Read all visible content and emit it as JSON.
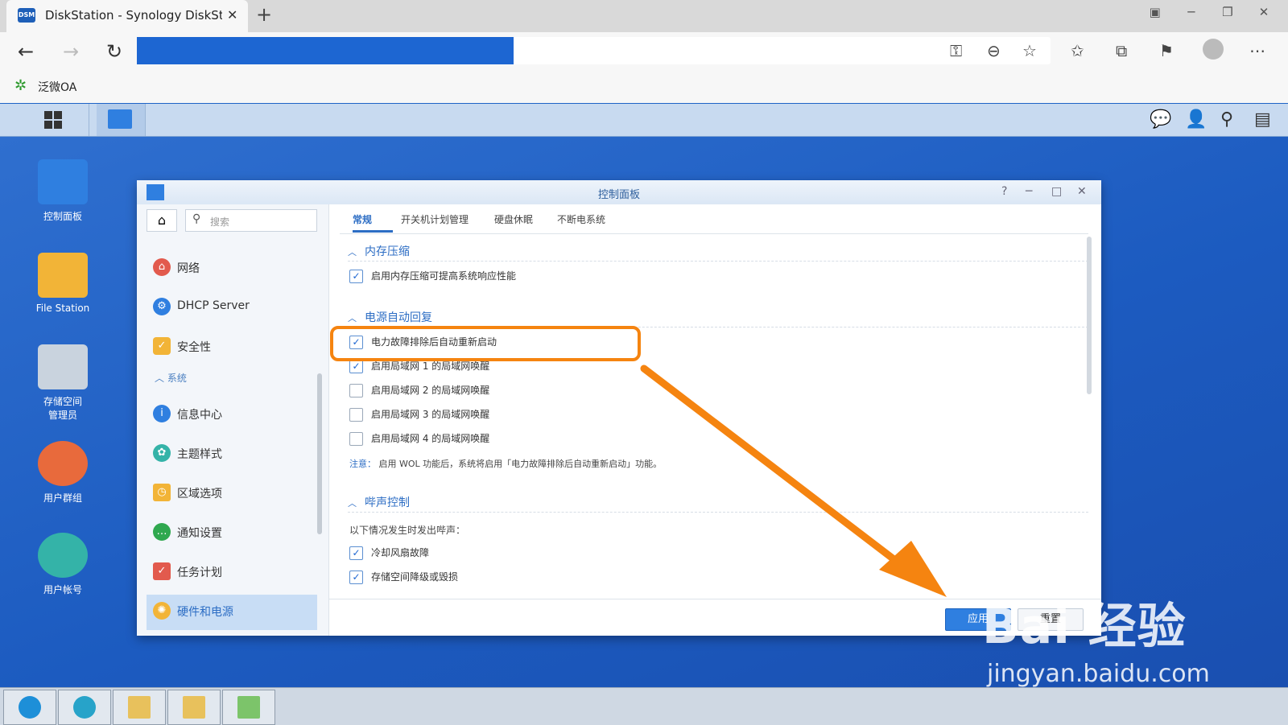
{
  "browser": {
    "tab_title": "DiskStation - Synology DiskStatic",
    "tab_favicon_text": "DSM",
    "favorites_bar_item": "泛微OA"
  },
  "dsm_desktop": {
    "icons": [
      {
        "label": "控制面板"
      },
      {
        "label": "File Station"
      },
      {
        "label": "存储空间\n管理员"
      },
      {
        "label": "用户群组"
      },
      {
        "label": "用户帐号"
      }
    ]
  },
  "control_panel": {
    "title": "控制面板",
    "search_placeholder": "搜索",
    "sidebar": {
      "items_top": [
        {
          "label": "网络"
        },
        {
          "label": "DHCP Server"
        },
        {
          "label": "安全性"
        }
      ],
      "group_label": "系统",
      "items_system": [
        {
          "label": "信息中心"
        },
        {
          "label": "主题样式"
        },
        {
          "label": "区域选项"
        },
        {
          "label": "通知设置"
        },
        {
          "label": "任务计划"
        },
        {
          "label": "硬件和电源"
        }
      ]
    },
    "tabs": [
      "常规",
      "开关机计划管理",
      "硬盘休眠",
      "不断电系统"
    ],
    "sections": {
      "memory": {
        "title": "内存压缩",
        "options": [
          {
            "label": "启用内存压缩可提高系统响应性能",
            "checked": true
          }
        ]
      },
      "power": {
        "title": "电源自动回复",
        "options": [
          {
            "label": "电力故障排除后自动重新启动",
            "checked": true
          },
          {
            "label": "启用局域网 1 的局域网唤醒",
            "checked": true
          },
          {
            "label": "启用局域网 2 的局域网唤醒",
            "checked": false
          },
          {
            "label": "启用局域网 3 的局域网唤醒",
            "checked": false
          },
          {
            "label": "启用局域网 4 的局域网唤醒",
            "checked": false
          }
        ],
        "note_label": "注意：",
        "note_text": "启用 WOL 功能后，系统将启用「电力故障排除后自动重新启动」功能。"
      },
      "beep": {
        "title": "哔声控制",
        "intro": "以下情况发生时发出哔声：",
        "options": [
          {
            "label": "冷却风扇故障",
            "checked": true
          },
          {
            "label": "存储空间降级或毁损",
            "checked": true
          }
        ]
      }
    },
    "buttons": {
      "apply": "应用",
      "reset": "重置"
    }
  },
  "watermark": {
    "main": "Bai  经验",
    "sub": "jingyan.baidu.com"
  },
  "colors": {
    "accent": "#2c6dc4",
    "highlight": "#f58410",
    "desktop": "#1e63c6"
  }
}
